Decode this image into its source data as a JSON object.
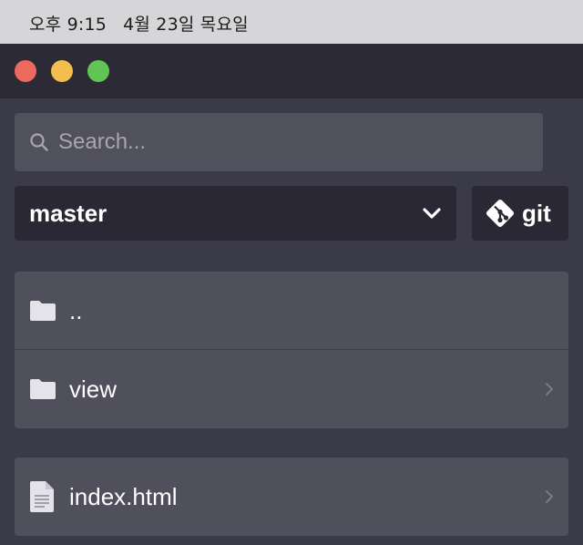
{
  "menubar": {
    "time": "오후 9:15",
    "date": "4월 23일 목요일"
  },
  "window": {
    "traffic_lights": [
      "close",
      "minimize",
      "zoom"
    ]
  },
  "search": {
    "placeholder": "Search...",
    "value": ""
  },
  "branch": {
    "selected": "master"
  },
  "git_button": {
    "label": "git"
  },
  "files": {
    "group1": [
      {
        "name": "..",
        "icon": "folder-icon",
        "has_chevron": false
      },
      {
        "name": "view",
        "icon": "folder-icon",
        "has_chevron": true
      }
    ],
    "group2": [
      {
        "name": "index.html",
        "icon": "file-icon",
        "has_chevron": true
      }
    ]
  },
  "colors": {
    "window_bg": "#3b3a48",
    "titlebar_bg": "#2b2a35",
    "list_bg": "#504f5c",
    "dark_button_bg": "#292834",
    "close": "#ef6a5e",
    "minimize": "#f3bd4f",
    "zoom": "#61c554"
  }
}
